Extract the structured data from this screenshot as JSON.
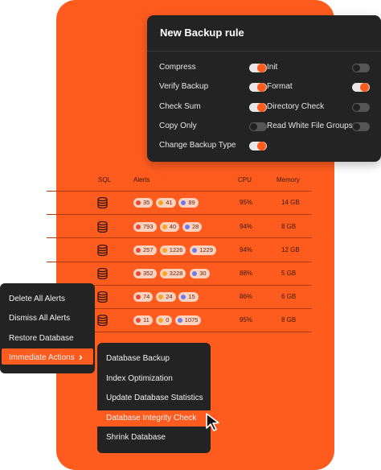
{
  "backup_rule": {
    "title": "New Backup rule",
    "left_options": [
      {
        "label": "Compress",
        "on": true
      },
      {
        "label": "Verify Backup",
        "on": true
      },
      {
        "label": "Check Sum",
        "on": true
      },
      {
        "label": "Copy Only",
        "on": false
      },
      {
        "label": "Change Backup Type",
        "on": true
      }
    ],
    "right_options": [
      {
        "label": "Init",
        "on": false
      },
      {
        "label": "Format",
        "on": true
      },
      {
        "label": "Directory Check",
        "on": false
      },
      {
        "label": "Read White File Groups",
        "on": false
      }
    ]
  },
  "table": {
    "headers": {
      "sql": "SQL",
      "alerts": "Alerts",
      "cpu": "CPU",
      "memory": "Memory"
    },
    "rows": [
      {
        "alerts": [
          "35",
          "41",
          "89"
        ],
        "cpu": "95%",
        "memory": "14 GB"
      },
      {
        "alerts": [
          "793",
          "40",
          "28"
        ],
        "cpu": "94%",
        "memory": "8 GB"
      },
      {
        "alerts": [
          "257",
          "1226",
          "1229"
        ],
        "cpu": "94%",
        "memory": "12 GB"
      },
      {
        "alerts": [
          "352",
          "3228",
          "30"
        ],
        "cpu": "88%",
        "memory": "5 GB"
      },
      {
        "alerts": [
          "74",
          "24",
          "15"
        ],
        "cpu": "86%",
        "memory": "6 GB"
      },
      {
        "alerts": [
          "11",
          "0",
          "1075"
        ],
        "cpu": "95%",
        "memory": "8 GB"
      }
    ]
  },
  "context_menu": {
    "items": [
      "Delete All Alerts",
      "Dismiss All Alerts",
      "Restore Database",
      "Immediate Actions"
    ],
    "submenu_arrow": "›"
  },
  "submenu": {
    "items": [
      "Database Backup",
      "Index Optimization",
      "Update Database Statistics",
      "Database Integrity Check",
      "Shrink Database"
    ]
  },
  "colors": {
    "accent": "#fe5c1f",
    "menu_bg": "#232323",
    "alert_red": "#e8473a",
    "alert_yellow": "#f5a623",
    "alert_blue": "#6b7cf0"
  },
  "icons": {
    "db_icon": "database-icon",
    "cursor": "mouse-pointer-icon"
  }
}
